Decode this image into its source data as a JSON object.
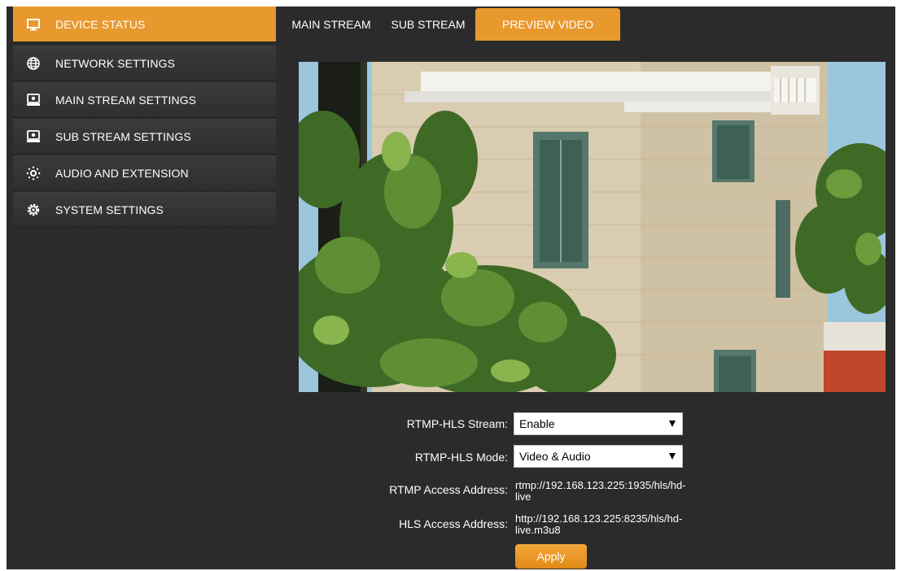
{
  "sidebar": {
    "items": [
      {
        "label": "DEVICE STATUS",
        "icon": "monitor-icon"
      },
      {
        "label": "NETWORK SETTINGS",
        "icon": "globe-icon"
      },
      {
        "label": "MAIN STREAM SETTINGS",
        "icon": "camera-icon"
      },
      {
        "label": "SUB STREAM SETTINGS",
        "icon": "camera-icon"
      },
      {
        "label": "AUDIO AND EXTENSION",
        "icon": "audio-extension-icon"
      },
      {
        "label": "SYSTEM SETTINGS",
        "icon": "gear-icon"
      }
    ],
    "active_index": 0
  },
  "tabs": [
    {
      "label": "MAIN STREAM"
    },
    {
      "label": "SUB STREAM"
    },
    {
      "label": "PREVIEW VIDEO"
    }
  ],
  "active_tab": 2,
  "form": {
    "rtmp_hls_stream": {
      "label": "RTMP-HLS Stream:",
      "value": "Enable"
    },
    "rtmp_hls_mode": {
      "label": "RTMP-HLS Mode:",
      "value": "Video & Audio"
    },
    "rtmp_access": {
      "label": "RTMP Access Address:",
      "line1": "rtmp://192.168.123.225:1935/hls/hd-",
      "line2": "live"
    },
    "hls_access": {
      "label": "HLS Access Address:",
      "line1": "http://192.168.123.225:8235/hls/hd-",
      "line2": "live.m3u8"
    },
    "apply_label": "Apply"
  },
  "colors": {
    "accent": "#e8992e",
    "panel": "#2b2b2b",
    "sidebar_item": "#363636"
  }
}
